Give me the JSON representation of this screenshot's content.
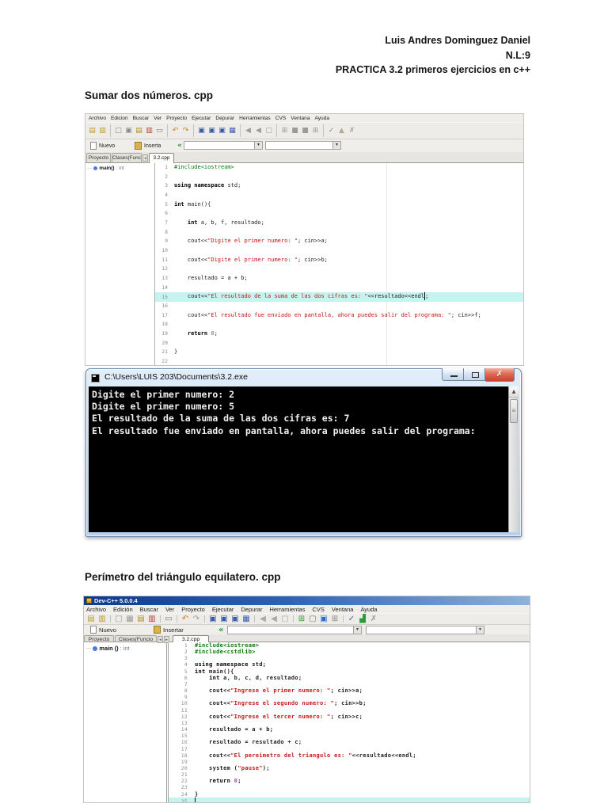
{
  "document": {
    "header": [
      "Luis Andres Dominguez Daniel",
      "N.L:9",
      "PRACTICA 3.2 primeros ejercicios en c++"
    ],
    "section_sum_title": "Sumar dos números. cpp",
    "section_perimeter_title": "Perímetro del triángulo equilatero. cpp"
  },
  "colors": {
    "syntax_include": "#0a7a0a",
    "syntax_string": "#c01818",
    "highlight_line": "#c6f3ef",
    "console_background": "#000000",
    "console_text": "#f0f0f0",
    "close_button_red": "#d05038",
    "classic_titlebar_blue": "#0b3a8c"
  },
  "ide1": {
    "menu": [
      "Archivo",
      "Edicion",
      "Buscar",
      "Ver",
      "Proyecto",
      "Ejecutar",
      "Depurar",
      "Herramientas",
      "CVS",
      "Ventana",
      "Ayuda"
    ],
    "toolbar_icons": [
      {
        "n": "open-file",
        "g": "▤",
        "c": "#c09a28"
      },
      {
        "n": "save-file",
        "g": "▥",
        "c": "#c09a28"
      },
      "|",
      {
        "n": "new-source",
        "g": "□",
        "c": "#8a8a8a"
      },
      {
        "n": "new-project",
        "g": "▣",
        "c": "#8a8a8a"
      },
      {
        "n": "open-project",
        "g": "▤",
        "c": "#b08c20"
      },
      {
        "n": "close-file",
        "g": "▥",
        "c": "#b2402e"
      },
      {
        "n": "print",
        "g": "▭",
        "c": "#777777"
      },
      "|",
      {
        "n": "undo",
        "g": "↶",
        "c": "#d27a1a"
      },
      {
        "n": "redo",
        "g": "↷",
        "c": "#d27a1a"
      },
      "|",
      {
        "n": "compile",
        "g": "▣",
        "c": "#3a5aa8"
      },
      {
        "n": "run",
        "g": "▣",
        "c": "#3a5aa8"
      },
      {
        "n": "compile-and-run",
        "g": "▣",
        "c": "#3a5aa8"
      },
      {
        "n": "rebuild-all",
        "g": "▦",
        "c": "#3a5aa8"
      },
      "|",
      {
        "n": "debug",
        "g": "◀",
        "c": "#9a9a9a"
      },
      {
        "n": "step-over",
        "g": "◀",
        "c": "#9a9a9a"
      },
      {
        "n": "stop-execution",
        "g": "▢",
        "c": "#9a9a9a"
      },
      "|",
      {
        "n": "profile-grid",
        "g": "⊞",
        "c": "#9a9a9a"
      },
      {
        "n": "profile-window-1",
        "g": "■",
        "c": "#9a9a9a"
      },
      {
        "n": "profile-window-2",
        "g": "■",
        "c": "#9a9a9a"
      },
      {
        "n": "profile-grid-2",
        "g": "⊞",
        "c": "#9a9a9a"
      },
      "|",
      {
        "n": "syntax-check",
        "g": "✓",
        "c": "#8a8a8a"
      },
      {
        "n": "alert",
        "g": "▲",
        "c": "#b8a898"
      },
      {
        "n": "abort",
        "g": "✗",
        "c": "#9a9a9a"
      }
    ],
    "nuevo_label": "Nuevo",
    "inserta_label": "Inserta",
    "green_bracket": "«",
    "left_tabs": [
      "Proyecto",
      "Clases(Funcio"
    ],
    "doc_tab": "3.2.cpp",
    "tree_main": "main()",
    "tree_type": ": int",
    "code": {
      "lines": [
        {
          "n": 1,
          "seg": [
            [
              "inc",
              "#include<iostream>"
            ]
          ]
        },
        {
          "n": 2,
          "seg": []
        },
        {
          "n": 3,
          "seg": [
            [
              "kw",
              "using"
            ],
            [
              "pln",
              " "
            ],
            [
              "kw",
              "namespace"
            ],
            [
              "pln",
              " std;"
            ]
          ]
        },
        {
          "n": 4,
          "seg": []
        },
        {
          "n": 5,
          "seg": [
            [
              "kw",
              "int"
            ],
            [
              "pln",
              " main(){"
            ]
          ]
        },
        {
          "n": 6,
          "seg": []
        },
        {
          "n": 7,
          "seg": [
            [
              "pln",
              "    "
            ],
            [
              "kw",
              "int"
            ],
            [
              "pln",
              " a, b, f, resultado;"
            ]
          ]
        },
        {
          "n": 8,
          "seg": []
        },
        {
          "n": 9,
          "seg": [
            [
              "pln",
              "    cout<<"
            ],
            [
              "str",
              "\"Digite el primer numero: \""
            ],
            [
              "pln",
              "; cin>>a;"
            ]
          ]
        },
        {
          "n": 10,
          "seg": []
        },
        {
          "n": 11,
          "seg": [
            [
              "pln",
              "    cout<<"
            ],
            [
              "str",
              "\"Digite el primer numero: \""
            ],
            [
              "pln",
              "; cin>>b;"
            ]
          ]
        },
        {
          "n": 12,
          "seg": []
        },
        {
          "n": 13,
          "seg": [
            [
              "pln",
              "    resultado = a + b;"
            ]
          ]
        },
        {
          "n": 14,
          "seg": []
        },
        {
          "n": 15,
          "hl": true,
          "seg": [
            [
              "pln",
              "    cout<<"
            ],
            [
              "str",
              "\"El resultado de la suma de las dos cifras es: \""
            ],
            [
              "pln",
              "<<resultado<<endl"
            ],
            [
              "cur",
              ""
            ],
            [
              "pln",
              ";"
            ]
          ]
        },
        {
          "n": 16,
          "seg": []
        },
        {
          "n": 17,
          "seg": [
            [
              "pln",
              "    cout<<"
            ],
            [
              "str",
              "\"El resultado fue enviado en pantalla, ahora puedes salir del programa: \""
            ],
            [
              "pln",
              "; cin>>f;"
            ]
          ]
        },
        {
          "n": 18,
          "seg": []
        },
        {
          "n": 19,
          "seg": [
            [
              "pln",
              "    "
            ],
            [
              "kw",
              "return"
            ],
            [
              "pln",
              " "
            ],
            [
              "num",
              "0"
            ],
            [
              "pln",
              ";"
            ]
          ]
        },
        {
          "n": 20,
          "seg": []
        },
        {
          "n": 21,
          "seg": [
            [
              "pln",
              "}"
            ]
          ]
        },
        {
          "n": 22,
          "seg": []
        }
      ]
    }
  },
  "console": {
    "title": "C:\\Users\\LUIS 203\\Documents\\3.2.exe",
    "close_glyph": "✗",
    "scroll_up_glyph": "▲",
    "scroll_thumb_glyph": "≡",
    "lines": [
      "Digite el primer numero: 2",
      "Digite el primer numero: 5",
      "El resultado de la suma de las dos cifras es: 7",
      "El resultado fue enviado en pantalla, ahora puedes salir del programa:"
    ]
  },
  "ide2": {
    "window_title": "Dev-C++ 5.0.0.4",
    "menu": [
      "Archivo",
      "Edición",
      "Buscar",
      "Ver",
      "Proyecto",
      "Ejecutar",
      "Depurar",
      "Herramientas",
      "CVS",
      "Ventana",
      "Ayuda"
    ],
    "toolbar_icons": [
      {
        "n": "open-file",
        "g": "▤",
        "c": "#c09a28"
      },
      {
        "n": "save-all",
        "g": "▥",
        "c": "#c09a28"
      },
      "|",
      {
        "n": "new-source",
        "g": "□",
        "c": "#9a9a9a"
      },
      {
        "n": "new-form",
        "g": "▦",
        "c": "#9a9a9a"
      },
      {
        "n": "open-project",
        "g": "▤",
        "c": "#b08c20"
      },
      {
        "n": "close-project",
        "g": "▥",
        "c": "#b2402e"
      },
      "|",
      {
        "n": "print",
        "g": "▭",
        "c": "#777777"
      },
      "|",
      {
        "n": "undo",
        "g": "↶",
        "c": "#d27a1a"
      },
      {
        "n": "redo",
        "g": "↷",
        "c": "#a0a0a0"
      },
      "|",
      {
        "n": "compile",
        "g": "▣",
        "c": "#3a5aa8"
      },
      {
        "n": "run",
        "g": "▣",
        "c": "#3a5aa8"
      },
      {
        "n": "compile-and-run",
        "g": "▣",
        "c": "#3a5aa8"
      },
      {
        "n": "rebuild-all",
        "g": "▦",
        "c": "#3a5aa8"
      },
      "|",
      {
        "n": "debug",
        "g": "◀",
        "c": "#a8a8a8"
      },
      {
        "n": "step-over",
        "g": "◀",
        "c": "#a8a8a8"
      },
      {
        "n": "stop-execution",
        "g": "▢",
        "c": "#a8a8a8"
      },
      "|",
      {
        "n": "new-project-wizard",
        "g": "⊞",
        "c": "#2a9a3a"
      },
      {
        "n": "window-layout-1",
        "g": "▢",
        "c": "#777777"
      },
      {
        "n": "window-layout-2",
        "g": "▣",
        "c": "#2a6acc"
      },
      {
        "n": "window-grid",
        "g": "⊞",
        "c": "#8a8a8a"
      },
      "|",
      {
        "n": "syntax-check",
        "g": "✓",
        "c": "#3a6acc"
      },
      {
        "n": "profile-chart",
        "g": "▟",
        "c": "#2a9a3a"
      },
      {
        "n": "close-x",
        "g": "✗",
        "c": "#9a9a9a"
      }
    ],
    "nuevo_label": "Nuevo",
    "inserta_label": "Insertar",
    "green_bracket": "«",
    "left_tabs": [
      "Proyecto",
      "Clases(Funcio"
    ],
    "doc_tab": "3.2.cpp",
    "tree_main": "main ()",
    "tree_type": ": int",
    "code": {
      "lines": [
        {
          "n": 1,
          "seg": [
            [
              "inc",
              "#include<iostream>"
            ]
          ]
        },
        {
          "n": 2,
          "seg": [
            [
              "inc",
              "#include<cstdlib>"
            ]
          ]
        },
        {
          "n": 3,
          "seg": []
        },
        {
          "n": 4,
          "seg": [
            [
              "kw",
              "using"
            ],
            [
              "pln",
              " "
            ],
            [
              "kw",
              "namespace"
            ],
            [
              "pln",
              " std;"
            ]
          ]
        },
        {
          "n": 5,
          "seg": [
            [
              "kw",
              "int"
            ],
            [
              "pln",
              " main(){"
            ]
          ]
        },
        {
          "n": 6,
          "seg": [
            [
              "pln",
              "    "
            ],
            [
              "kw",
              "int"
            ],
            [
              "pln",
              " a, b, c, d, resultado;"
            ]
          ]
        },
        {
          "n": 7,
          "seg": []
        },
        {
          "n": 8,
          "seg": [
            [
              "pln",
              "    cout<<"
            ],
            [
              "str",
              "\"Ingrese el primer numero: \""
            ],
            [
              "pln",
              "; cin>>a;"
            ]
          ]
        },
        {
          "n": 9,
          "seg": []
        },
        {
          "n": 10,
          "seg": [
            [
              "pln",
              "    cout<<"
            ],
            [
              "str",
              "\"Ingrese el segundo numero: \""
            ],
            [
              "pln",
              "; cin>>b;"
            ]
          ]
        },
        {
          "n": 11,
          "seg": []
        },
        {
          "n": 12,
          "seg": [
            [
              "pln",
              "    cout<<"
            ],
            [
              "str",
              "\"Ingrese el tercer numero: \""
            ],
            [
              "pln",
              "; cin>>c;"
            ]
          ]
        },
        {
          "n": 13,
          "seg": []
        },
        {
          "n": 14,
          "seg": [
            [
              "pln",
              "    resultado = a + b;"
            ]
          ]
        },
        {
          "n": 15,
          "seg": []
        },
        {
          "n": 16,
          "seg": [
            [
              "pln",
              "    resultado = resultado + c;"
            ]
          ]
        },
        {
          "n": 17,
          "seg": []
        },
        {
          "n": 18,
          "seg": [
            [
              "pln",
              "    cout<<"
            ],
            [
              "str",
              "\"El pereimetro del triangulo es: \""
            ],
            [
              "pln",
              "<<resultado<<endl;"
            ]
          ]
        },
        {
          "n": 19,
          "seg": []
        },
        {
          "n": 20,
          "seg": [
            [
              "pln",
              "    system ("
            ],
            [
              "str",
              "\"pause\""
            ],
            [
              "pln",
              ");"
            ]
          ]
        },
        {
          "n": 21,
          "seg": []
        },
        {
          "n": 22,
          "seg": [
            [
              "pln",
              "    "
            ],
            [
              "kw",
              "return"
            ],
            [
              "pln",
              " "
            ],
            [
              "num",
              "0"
            ],
            [
              "pln",
              ";"
            ]
          ]
        },
        {
          "n": 23,
          "seg": []
        },
        {
          "n": 24,
          "seg": [
            [
              "pln",
              "}"
            ]
          ]
        },
        {
          "n": 25,
          "hl": true,
          "seg": [
            [
              "cur",
              ""
            ]
          ]
        }
      ]
    }
  }
}
